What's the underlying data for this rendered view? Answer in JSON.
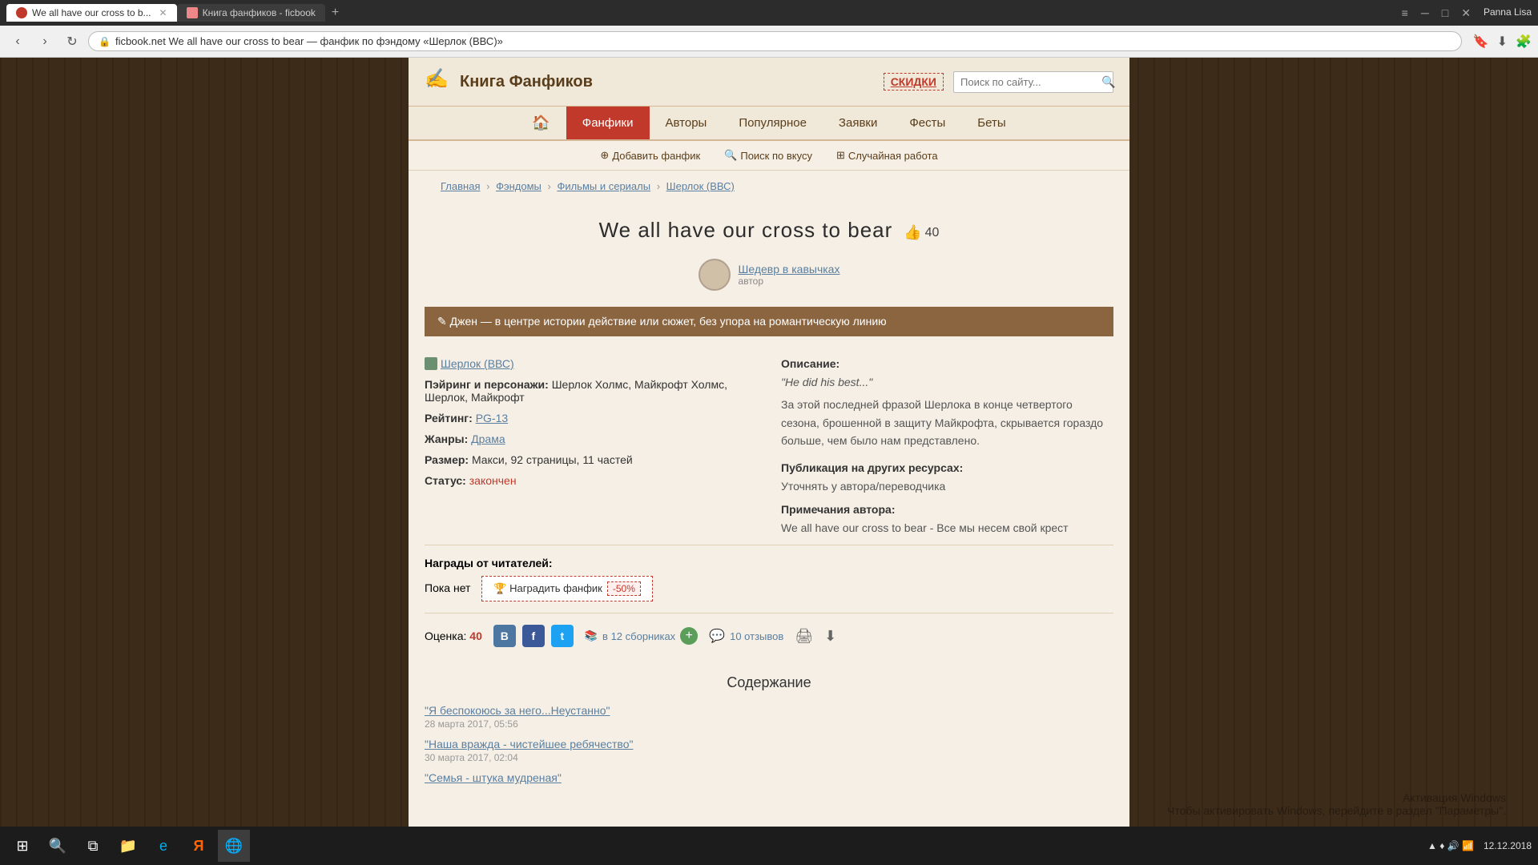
{
  "browser": {
    "tab_active": "We all have our cross to b...",
    "tab_inactive": "Книга фанфиков - ficbook",
    "tab_new": "+",
    "address_url": "ficbook.net   We all have our cross to bear — фанфик по фэндому «Шерлок (ВВС)»",
    "lock_icon": "🔒",
    "window_controls": {
      "minimize": "─",
      "maximize": "□",
      "close": "✕",
      "settings": "≡"
    },
    "user_name": "Panna Lisa"
  },
  "site": {
    "logo_text": "Книга Фанфиков",
    "discount_label": "СКИДКИ",
    "search_placeholder": "Поиск по сайту..."
  },
  "nav": {
    "items": [
      {
        "label": "🏠",
        "id": "home",
        "active": false
      },
      {
        "label": "Фанфики",
        "id": "fanfics",
        "active": true
      },
      {
        "label": "Авторы",
        "id": "authors",
        "active": false
      },
      {
        "label": "Популярное",
        "id": "popular",
        "active": false
      },
      {
        "label": "Заявки",
        "id": "requests",
        "active": false
      },
      {
        "label": "Фесты",
        "id": "fests",
        "active": false
      },
      {
        "label": "Беты",
        "id": "betas",
        "active": false
      }
    ]
  },
  "subnav": {
    "items": [
      {
        "label": "Добавить фанфик",
        "icon": "+"
      },
      {
        "label": "Поиск по вкусу",
        "icon": "🔍"
      },
      {
        "label": "Случайная работа",
        "icon": "⊞"
      }
    ]
  },
  "breadcrumb": {
    "items": [
      {
        "label": "Главная",
        "href": "#"
      },
      {
        "label": "Фэндомы",
        "href": "#"
      },
      {
        "label": "Фильмы и сериалы",
        "href": "#"
      },
      {
        "label": "Шерлок (ВВС)",
        "href": "#"
      }
    ]
  },
  "fanfic": {
    "title": "We all have our cross to bear",
    "likes": "40",
    "author_name": "Шедевр в кавычках",
    "author_label": "автор",
    "genre_banner": "✎ Джен — в центре истории действие или сюжет, без упора на романтическую линию",
    "fandom": "Шерлок (ВВС)",
    "pairing_label": "Пэйринг и персонажи:",
    "pairing_value": "Шерлок Холмс, Майкрофт Холмс, Шерлок, Майкрофт",
    "rating_label": "Рейтинг:",
    "rating_value": "PG-13",
    "genres_label": "Жанры:",
    "genres_value": "Драма",
    "size_label": "Размер:",
    "size_value": "Макси, 92 страницы, 11 частей",
    "status_label": "Статус:",
    "status_value": "закончен",
    "description_heading": "Описание:",
    "description_quote": "\"He did his best...\"",
    "description_text": "За этой последней фразой Шерлока в конце четвертого сезона, брошенной в защиту Майкрофта, скрывается гораздо больше, чем было нам представлено.",
    "other_resources_heading": "Публикация на других ресурсах:",
    "other_resources_value": "Уточнять у автора/переводчика",
    "notes_heading": "Примечания автора:",
    "notes_value": "We all have our cross to bear - Все мы несем свой крест",
    "rewards_heading": "Награды от читателей:",
    "rewards_none": "Пока нет",
    "reward_btn_label": "🏆 Наградить фанфик",
    "discount_pct": "-50%",
    "rating_score_label": "Оценка:",
    "rating_score": "40",
    "collections_count": "12",
    "collections_label": "в 12 сборниках",
    "reviews_label": "10 отзывов",
    "contents_heading": "Содержание",
    "chapters": [
      {
        "title": "\"Я беспокоюсь за него...Неустанно\"",
        "date": "28 марта 2017, 05:56"
      },
      {
        "title": "\"Наша вражда - чистейшее ребячество\"",
        "date": "30 марта 2017, 02:04"
      },
      {
        "title": "\"Семья - штука мудреная\"",
        "date": ""
      }
    ]
  },
  "windows": {
    "activate_line1": "Активация Windows",
    "activate_line2": "Чтобы активировать Windows, перейдите в раздел \"Параметры\"."
  },
  "taskbar": {
    "date": "12.12.2018",
    "time": "▲ ♦ Ψ ▶"
  }
}
